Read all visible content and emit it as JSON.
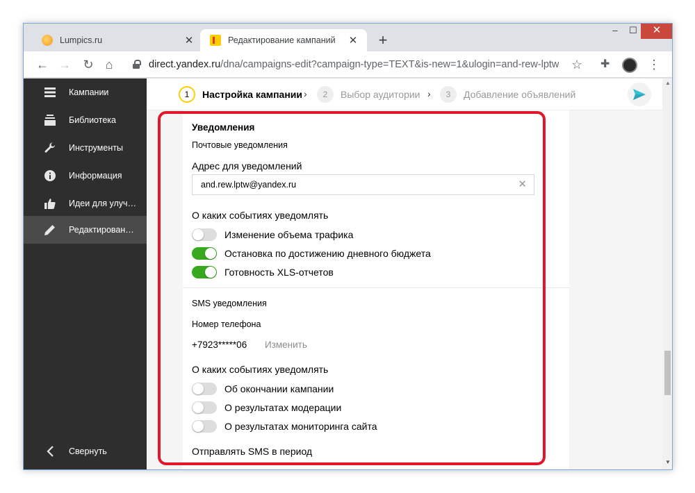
{
  "browser": {
    "tabs": [
      {
        "title": "Lumpics.ru",
        "active": false
      },
      {
        "title": "Редактирование кампаний",
        "active": true
      }
    ],
    "url_host": "direct.yandex.ru",
    "url_path": "/dna/campaigns-edit?campaign-type=TEXT&is-new=1&ulogin=and-rew-lptw",
    "window_controls": {
      "minimize": "–",
      "maximize": "☐",
      "close": "✕"
    }
  },
  "sidebar": {
    "items": [
      {
        "label": "Кампании",
        "icon": "list-icon"
      },
      {
        "label": "Библиотека",
        "icon": "library-icon"
      },
      {
        "label": "Инструменты",
        "icon": "wrench-icon"
      },
      {
        "label": "Информация",
        "icon": "info-icon"
      },
      {
        "label": "Идеи для улуч…",
        "icon": "thumbs-up-icon"
      },
      {
        "label": "Редактирован…",
        "icon": "pencil-icon",
        "active": true
      }
    ],
    "collapse_label": "Свернуть"
  },
  "steps": [
    {
      "num": "1",
      "label": "Настройка кампании",
      "active": true
    },
    {
      "num": "2",
      "label": "Выбор аудитории",
      "active": false
    },
    {
      "num": "3",
      "label": "Добавление объявлений",
      "active": false
    }
  ],
  "notifications": {
    "title": "Уведомления",
    "email": {
      "subtitle": "Почтовые уведомления",
      "address_label": "Адрес для уведомлений",
      "address_value": "and.rew.lptw@yandex.ru",
      "events_label": "О каких событиях уведомлять",
      "toggles": [
        {
          "label": "Изменение объема трафика",
          "on": false
        },
        {
          "label": "Остановка по достижению дневного бюджета",
          "on": true
        },
        {
          "label": "Готовность XLS-отчетов",
          "on": true
        }
      ]
    },
    "sms": {
      "subtitle": "SMS уведомления",
      "phone_label": "Номер телефона",
      "phone_value": "+7923*****06",
      "change_link": "Изменить",
      "events_label": "О каких событиях уведомлять",
      "toggles": [
        {
          "label": "Об окончании кампании",
          "on": false
        },
        {
          "label": "О результатах модерации",
          "on": false
        },
        {
          "label": "О результатах мониторинга сайта",
          "on": false
        }
      ],
      "period_label": "Отправлять SMS в период"
    }
  },
  "colors": {
    "accent_toggle_on": "#38a81f",
    "highlight_border": "#e0182a",
    "step_active_ring": "#ffcc00"
  }
}
